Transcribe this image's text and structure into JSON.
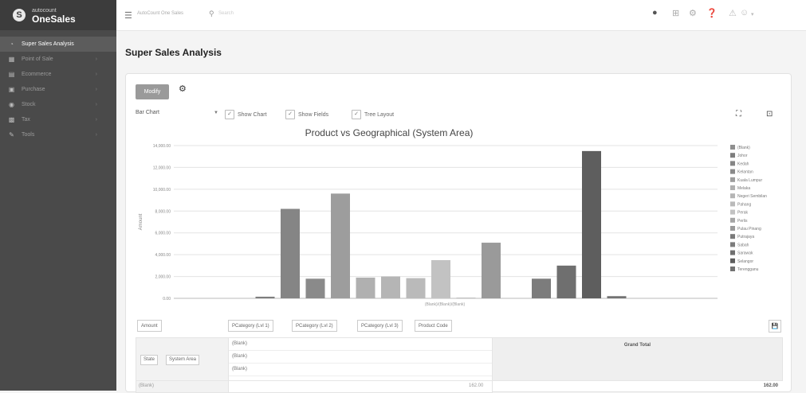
{
  "app": {
    "logo_letter": "S",
    "logo_small": "autocount",
    "logo_big": "OneSales"
  },
  "sidebar": {
    "items": [
      {
        "label": "Super Sales Analysis",
        "icon": "chart-icon",
        "glyph": "◔",
        "active": true
      },
      {
        "label": "Point of Sale",
        "icon": "pos-icon",
        "glyph": "▦",
        "active": false
      },
      {
        "label": "Ecommerce",
        "icon": "cart-icon",
        "glyph": "▤",
        "active": false
      },
      {
        "label": "Purchase",
        "icon": "purchase-icon",
        "glyph": "▣",
        "active": false
      },
      {
        "label": "Stock",
        "icon": "stock-icon",
        "glyph": "◉",
        "active": false
      },
      {
        "label": "Tax",
        "icon": "tax-icon",
        "glyph": "▩",
        "active": false
      },
      {
        "label": "Tools",
        "icon": "tools-icon",
        "glyph": "✎",
        "active": false
      }
    ]
  },
  "topbar": {
    "search_label": "AutoCount One Sales",
    "search_placeholder": "Search"
  },
  "page": {
    "title": "Super Sales Analysis"
  },
  "toolbar": {
    "modify_label": "Modify",
    "chart_type": "Bar Chart",
    "show_chart_label": "Show Chart",
    "show_fields_label": "Show Fields",
    "tree_layout_label": "Tree Layout"
  },
  "chart_data": {
    "type": "bar",
    "title": "Product vs Geographical (System Area)",
    "xlabel": "(Blank)/(Blank)/(Blank)",
    "ylabel": "Amount",
    "ylim": [
      0,
      14000
    ],
    "yticks": [
      0,
      2000,
      4000,
      6000,
      8000,
      10000,
      12000,
      14000
    ],
    "ytick_labels": [
      "0.00",
      "2,000.00",
      "4,000.00",
      "6,000.00",
      "8,000.00",
      "10,000.00",
      "12,000.00",
      "14,000.00"
    ],
    "grid": true,
    "legend_placement": "right",
    "series": [
      {
        "name": "(Blank)",
        "color": "#8f8f8f",
        "values": [
          0
        ]
      },
      {
        "name": "Johor",
        "color": "#7e7e7e",
        "values": [
          150
        ]
      },
      {
        "name": "Kedah",
        "color": "#858585",
        "values": [
          8200
        ]
      },
      {
        "name": "Kelantan",
        "color": "#8a8a8a",
        "values": [
          1800
        ]
      },
      {
        "name": "Kuala Lumpur",
        "color": "#9d9d9d",
        "values": [
          9600
        ]
      },
      {
        "name": "Melaka",
        "color": "#b0b0b0",
        "values": [
          1900
        ]
      },
      {
        "name": "Negeri Sembilan",
        "color": "#b5b5b5",
        "values": [
          2000
        ]
      },
      {
        "name": "Pahang",
        "color": "#bababa",
        "values": [
          1850
        ]
      },
      {
        "name": "Perak",
        "color": "#c2c2c2",
        "values": [
          3500
        ]
      },
      {
        "name": "Perlis",
        "color": "#a5a5a5",
        "values": [
          50
        ]
      },
      {
        "name": "Pulau Pinang",
        "color": "#9a9a9a",
        "values": [
          5100
        ]
      },
      {
        "name": "Putrajaya",
        "color": "#7a7a7a",
        "values": [
          0
        ]
      },
      {
        "name": "Sabah",
        "color": "#7c7c7c",
        "values": [
          1800
        ]
      },
      {
        "name": "Sarawak",
        "color": "#6f6f6f",
        "values": [
          3000
        ]
      },
      {
        "name": "Selangor",
        "color": "#5e5e5e",
        "values": [
          13500
        ]
      },
      {
        "name": "Terengganu",
        "color": "#727272",
        "values": [
          200
        ]
      }
    ]
  },
  "table": {
    "measure_chip": "Amount",
    "column_chips": [
      "PCategory (Lvl 1)",
      "PCategory (Lvl 2)",
      "PCategory (Lvl 3)",
      "Product Code"
    ],
    "row_chips": [
      "State",
      "System Area"
    ],
    "blank_rows": [
      "(Blank)",
      "(Blank)",
      "(Blank)"
    ],
    "grand_total_label": "Grand Total",
    "first_row": {
      "label": "(Blank)",
      "value": "162.00",
      "total": "162.00"
    }
  }
}
